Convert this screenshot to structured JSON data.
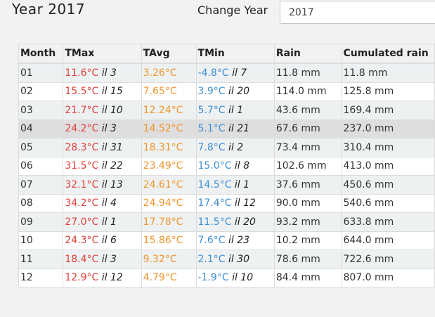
{
  "header": {
    "title": "Year 2017",
    "change_year_label": "Change Year",
    "year_input_value": "2017"
  },
  "table": {
    "columns": [
      "Month",
      "TMax",
      "TAvg",
      "TMin",
      "Rain",
      "Cumulated rain"
    ],
    "highlighted_row": 3,
    "colors": {
      "tmax": "#e0403a",
      "tavg": "#f0962b",
      "tmin": "#3f8fd6"
    },
    "rows": [
      {
        "month": "01",
        "tmax": "11.6°C",
        "tmax_day": "il 3",
        "tavg": "3.26°C",
        "tmin": "-4.8°C",
        "tmin_day": "il 7",
        "rain": "11.8 mm",
        "cum": "11.8 mm"
      },
      {
        "month": "02",
        "tmax": "15.5°C",
        "tmax_day": "il 15",
        "tavg": "7.65°C",
        "tmin": "3.9°C",
        "tmin_day": "il 20",
        "rain": "114.0 mm",
        "cum": "125.8 mm"
      },
      {
        "month": "03",
        "tmax": "21.7°C",
        "tmax_day": "il 10",
        "tavg": "12.24°C",
        "tmin": "5.7°C",
        "tmin_day": "il 1",
        "rain": "43.6 mm",
        "cum": "169.4 mm"
      },
      {
        "month": "04",
        "tmax": "24.2°C",
        "tmax_day": "il 3",
        "tavg": "14.52°C",
        "tmin": "5.1°C",
        "tmin_day": "il 21",
        "rain": "67.6 mm",
        "cum": "237.0 mm"
      },
      {
        "month": "05",
        "tmax": "28.3°C",
        "tmax_day": "il 31",
        "tavg": "18.31°C",
        "tmin": "7.8°C",
        "tmin_day": "il 2",
        "rain": "73.4 mm",
        "cum": "310.4 mm"
      },
      {
        "month": "06",
        "tmax": "31.5°C",
        "tmax_day": "il 22",
        "tavg": "23.49°C",
        "tmin": "15.0°C",
        "tmin_day": "il 8",
        "rain": "102.6 mm",
        "cum": "413.0 mm"
      },
      {
        "month": "07",
        "tmax": "32.1°C",
        "tmax_day": "il 13",
        "tavg": "24.61°C",
        "tmin": "14.5°C",
        "tmin_day": "il 1",
        "rain": "37.6 mm",
        "cum": "450.6 mm"
      },
      {
        "month": "08",
        "tmax": "34.2°C",
        "tmax_day": "il 4",
        "tavg": "24.94°C",
        "tmin": "17.4°C",
        "tmin_day": "il 12",
        "rain": "90.0 mm",
        "cum": "540.6 mm"
      },
      {
        "month": "09",
        "tmax": "27.0°C",
        "tmax_day": "il 1",
        "tavg": "17.78°C",
        "tmin": "11.5°C",
        "tmin_day": "il 20",
        "rain": "93.2 mm",
        "cum": "633.8 mm"
      },
      {
        "month": "10",
        "tmax": "24.3°C",
        "tmax_day": "il 6",
        "tavg": "15.86°C",
        "tmin": "7.6°C",
        "tmin_day": "il 23",
        "rain": "10.2 mm",
        "cum": "644.0 mm"
      },
      {
        "month": "11",
        "tmax": "18.4°C",
        "tmax_day": "il 3",
        "tavg": "9.32°C",
        "tmin": "2.1°C",
        "tmin_day": "il 30",
        "rain": "78.6 mm",
        "cum": "722.6 mm"
      },
      {
        "month": "12",
        "tmax": "12.9°C",
        "tmax_day": "il 12",
        "tavg": "4.79°C",
        "tmin": "-1.9°C",
        "tmin_day": "il 10",
        "rain": "84.4 mm",
        "cum": "807.0 mm"
      }
    ]
  }
}
